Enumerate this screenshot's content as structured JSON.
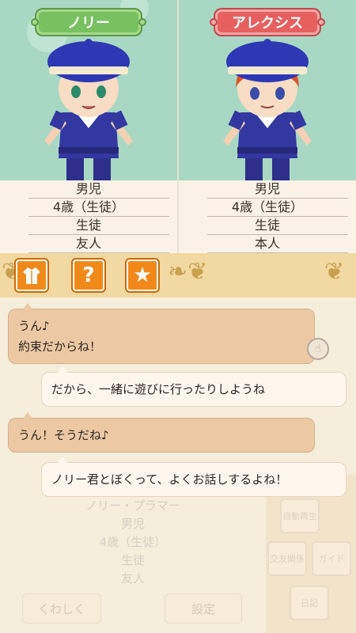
{
  "characters": [
    {
      "name": "ノリー",
      "tag_color": "#78c060",
      "info": [
        "男児",
        "4歳（生徒）",
        "生徒",
        "友人"
      ]
    },
    {
      "name": "アレクシス",
      "tag_color": "#e66060",
      "info": [
        "男児",
        "4歳（生徒）",
        "生徒",
        "本人"
      ]
    }
  ],
  "toolbar": {
    "buttons": [
      {
        "icon": "shirt-icon"
      },
      {
        "icon": "question-icon"
      },
      {
        "icon": "star-icon"
      }
    ]
  },
  "chat": [
    {
      "speaker": "mine",
      "lines": [
        "うん♪",
        "約束だからね！"
      ]
    },
    {
      "speaker": "theirs",
      "lines": [
        "だから、一緒に遊びに行ったりしようね"
      ]
    },
    {
      "speaker": "mine",
      "lines": [
        "うん！そうだね♪"
      ]
    },
    {
      "speaker": "theirs",
      "lines": [
        "ノリー君とぼくって、よくお話しするよね！"
      ]
    }
  ],
  "background_profile": {
    "name": "ノリー・プラマー",
    "info": [
      "男児",
      "4歳（生徒）",
      "生徒",
      "友人"
    ],
    "detail_button": "くわしく",
    "setting_button": "設定"
  },
  "side_menu": [
    "自動再生",
    "交友関係",
    "ガイド",
    "日記"
  ]
}
